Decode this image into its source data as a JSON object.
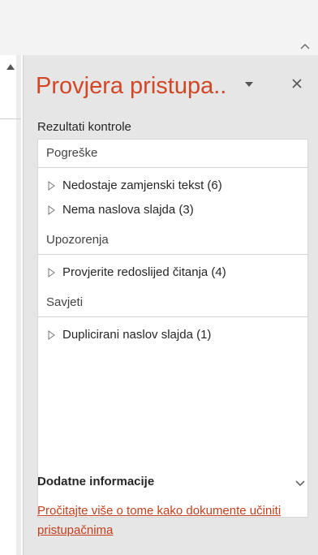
{
  "pane": {
    "title": "Provjera pristupa..",
    "results_label": "Rezultati kontrole",
    "sections": [
      {
        "header": "Pogreške",
        "items": [
          "Nedostaje zamjenski tekst (6)",
          "Nema naslova slajda (3)"
        ]
      },
      {
        "header": "Upozorenja",
        "items": [
          "Provjerite redoslijed čitanja (4)"
        ]
      },
      {
        "header": "Savjeti",
        "items": [
          "Duplicirani naslov slajda (1)"
        ]
      }
    ],
    "more_info": {
      "label": "Dodatne informacije",
      "link": "Pročitajte više o tome kako dokumente učiniti pristupačnima"
    }
  },
  "colors": {
    "accent": "#d24726",
    "link": "#c43e1c"
  },
  "icons": [
    "chevron-up-icon",
    "scroll-up-arrow-icon",
    "dropdown-arrow-icon",
    "close-icon",
    "expand-triangle-icon",
    "chevron-down-icon"
  ]
}
